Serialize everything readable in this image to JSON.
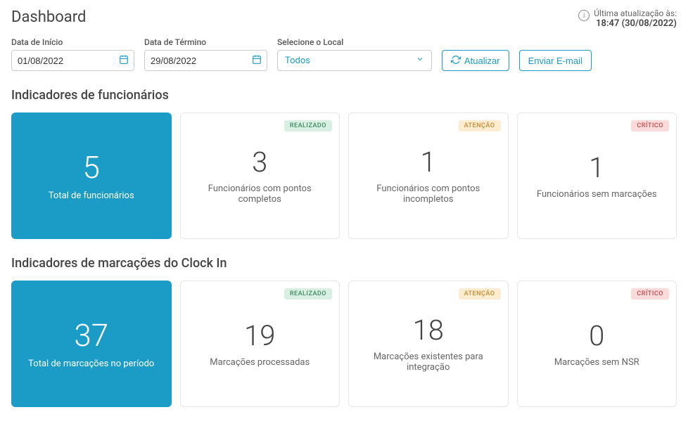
{
  "header": {
    "title": "Dashboard",
    "lastUpdateLabel": "Última atualização às:",
    "lastUpdateTime": "18:47 (30/08/2022)"
  },
  "filters": {
    "startDate": {
      "label": "Data de Início",
      "value": "01/08/2022"
    },
    "endDate": {
      "label": "Data de Término",
      "value": "29/08/2022"
    },
    "location": {
      "label": "Selecione o Local",
      "value": "Todos"
    },
    "refreshLabel": "Atualizar",
    "emailLabel": "Enviar E-mail"
  },
  "sections": {
    "employees": {
      "title": "Indicadores de funcionários",
      "cards": [
        {
          "value": "5",
          "label": "Total de funcionários",
          "primary": true
        },
        {
          "value": "3",
          "label": "Funcionários com pontos completos",
          "badge": "REALIZADO",
          "badgeClass": "realizado"
        },
        {
          "value": "1",
          "label": "Funcionários com pontos incompletos",
          "badge": "ATENÇÃO",
          "badgeClass": "atencao"
        },
        {
          "value": "1",
          "label": "Funcionários sem marcações",
          "badge": "CRÍTICO",
          "badgeClass": "critico"
        }
      ]
    },
    "clockin": {
      "title": "Indicadores de marcações do Clock In",
      "cards": [
        {
          "value": "37",
          "label": "Total de marcações no período",
          "primary": true
        },
        {
          "value": "19",
          "label": "Marcações processadas",
          "badge": "REALIZADO",
          "badgeClass": "realizado"
        },
        {
          "value": "18",
          "label": "Marcações existentes para integração",
          "badge": "ATENÇÃO",
          "badgeClass": "atencao"
        },
        {
          "value": "0",
          "label": "Marcações sem NSR",
          "badge": "CRÍTICO",
          "badgeClass": "critico"
        }
      ]
    }
  }
}
